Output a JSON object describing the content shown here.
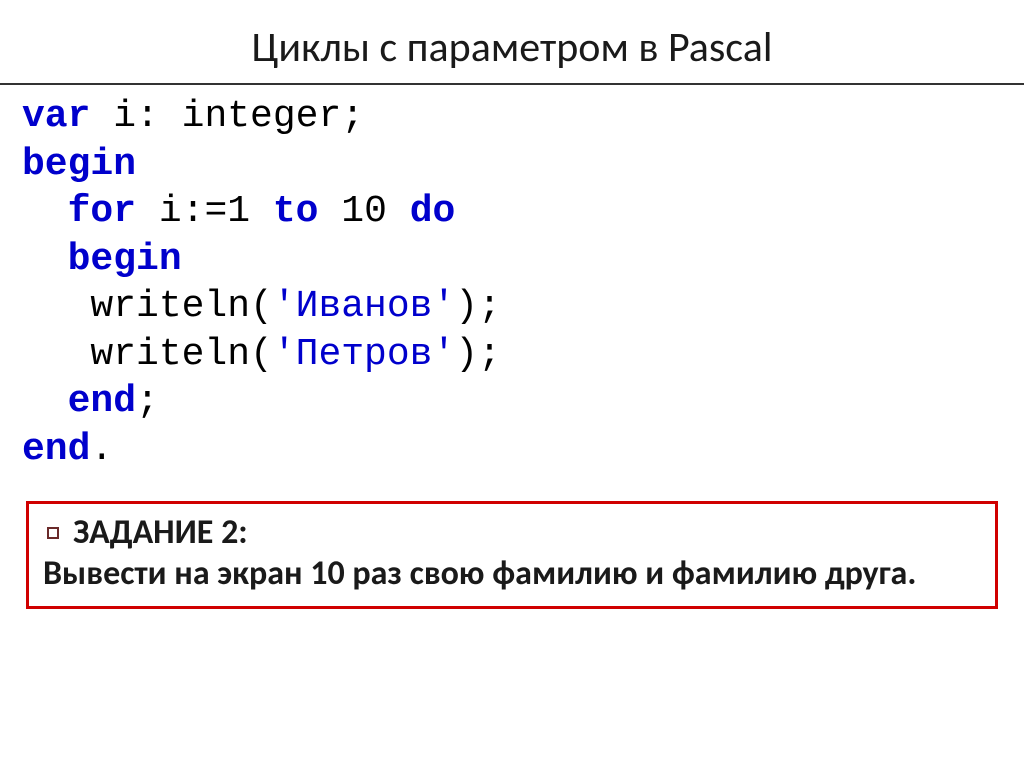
{
  "title": "Циклы с параметром в Pascal",
  "code": {
    "l1_kw_var": "var",
    "l1_rest": " i: integer;",
    "l2_kw_begin": "begin",
    "l3_indent": "  ",
    "l3_kw_for": "for",
    "l3_mid": " i:=1 ",
    "l3_kw_to": "to",
    "l3_mid2": " 10 ",
    "l3_kw_do": "do",
    "l4_indent": "  ",
    "l4_kw_begin": "begin",
    "l5_indent": "   writeln(",
    "l5_str": "'Иванов'",
    "l5_end": ");",
    "l6_indent": "   writeln(",
    "l6_str": "'Петров'",
    "l6_end": ");",
    "l7_indent": "  ",
    "l7_kw_end": "end",
    "l7_semi": ";",
    "l8_kw_end": "end",
    "l8_dot": "."
  },
  "task": {
    "label": "ЗАДАНИЕ 2:",
    "body": "Вывести на экран 10 раз свою фамилию и фамилию друга."
  }
}
